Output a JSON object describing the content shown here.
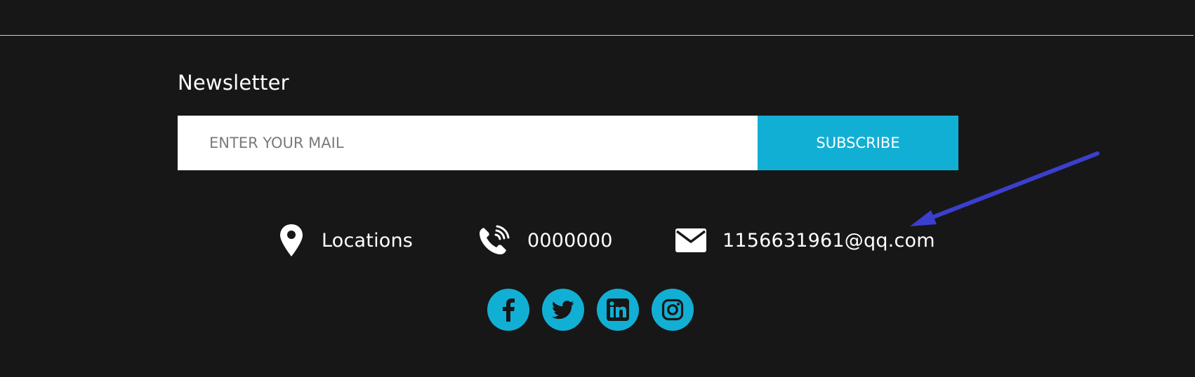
{
  "newsletter": {
    "title": "Newsletter",
    "input_placeholder": "ENTER YOUR MAIL",
    "input_value": "",
    "button_label": "SUBSCRIBE"
  },
  "contact": {
    "location_text": "Locations",
    "phone_text": "0000000",
    "email_text": "1156631961@qq.com"
  },
  "social": {
    "items": [
      {
        "icon": "facebook-icon"
      },
      {
        "icon": "twitter-icon"
      },
      {
        "icon": "linkedin-icon"
      },
      {
        "icon": "instagram-icon"
      }
    ]
  },
  "colors": {
    "background": "#171717",
    "accent": "#12afd5",
    "annotation_arrow": "#3b3fcf"
  }
}
